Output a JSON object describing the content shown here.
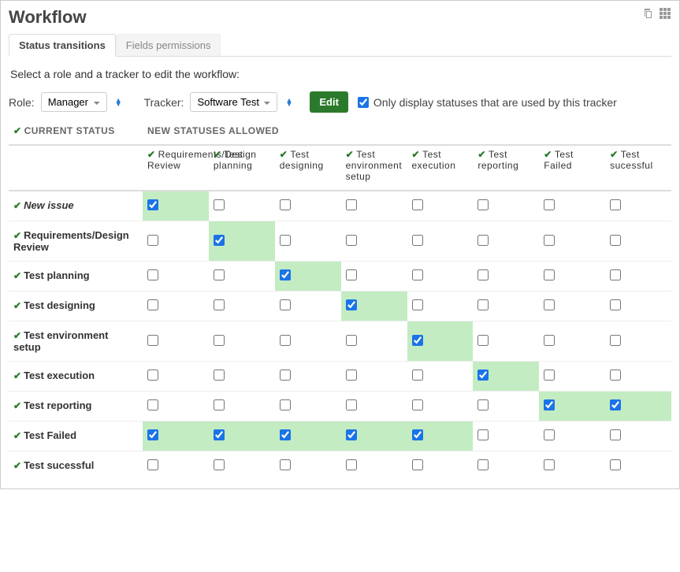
{
  "header": {
    "title": "Workflow"
  },
  "tabs": {
    "status_transitions": "Status transitions",
    "fields_permissions": "Fields permissions"
  },
  "intro": "Select a role and a tracker to edit the workflow:",
  "controls": {
    "role_label": "Role:",
    "role_value": "Manager",
    "tracker_label": "Tracker:",
    "tracker_value": "Software Test",
    "edit_label": "Edit",
    "filter_label": "Only display statuses that are used by this tracker",
    "filter_checked": true
  },
  "table": {
    "current_status_header": "CURRENT STATUS",
    "new_statuses_header": "NEW STATUSES ALLOWED",
    "columns": [
      "Requirements/Design Review",
      "Test planning",
      "Test designing",
      "Test environment setup",
      "Test execution",
      "Test reporting",
      "Test Failed",
      "Test sucessful"
    ],
    "rows": [
      {
        "label": "New issue",
        "italic": true,
        "cells": [
          {
            "v": true,
            "hl": true
          },
          {
            "v": false
          },
          {
            "v": false
          },
          {
            "v": false
          },
          {
            "v": false
          },
          {
            "v": false
          },
          {
            "v": false
          },
          {
            "v": false
          }
        ]
      },
      {
        "label": "Requirements/Design Review",
        "cells": [
          {
            "v": false
          },
          {
            "v": true,
            "hl": true
          },
          {
            "v": false
          },
          {
            "v": false
          },
          {
            "v": false
          },
          {
            "v": false
          },
          {
            "v": false
          },
          {
            "v": false
          }
        ]
      },
      {
        "label": "Test planning",
        "cells": [
          {
            "v": false
          },
          {
            "v": false
          },
          {
            "v": true,
            "hl": true
          },
          {
            "v": false
          },
          {
            "v": false
          },
          {
            "v": false
          },
          {
            "v": false
          },
          {
            "v": false
          }
        ]
      },
      {
        "label": "Test designing",
        "cells": [
          {
            "v": false
          },
          {
            "v": false
          },
          {
            "v": false
          },
          {
            "v": true,
            "hl": true
          },
          {
            "v": false
          },
          {
            "v": false
          },
          {
            "v": false
          },
          {
            "v": false
          }
        ]
      },
      {
        "label": "Test environment setup",
        "cells": [
          {
            "v": false
          },
          {
            "v": false
          },
          {
            "v": false
          },
          {
            "v": false
          },
          {
            "v": true,
            "hl": true
          },
          {
            "v": false
          },
          {
            "v": false
          },
          {
            "v": false
          }
        ]
      },
      {
        "label": "Test execution",
        "cells": [
          {
            "v": false
          },
          {
            "v": false
          },
          {
            "v": false
          },
          {
            "v": false
          },
          {
            "v": false
          },
          {
            "v": true,
            "hl": true
          },
          {
            "v": false
          },
          {
            "v": false
          }
        ]
      },
      {
        "label": "Test reporting",
        "cells": [
          {
            "v": false
          },
          {
            "v": false
          },
          {
            "v": false
          },
          {
            "v": false
          },
          {
            "v": false
          },
          {
            "v": false
          },
          {
            "v": true,
            "hl": true
          },
          {
            "v": true,
            "hl": true
          }
        ]
      },
      {
        "label": "Test Failed",
        "cells": [
          {
            "v": true,
            "hl": true
          },
          {
            "v": true,
            "hl": true
          },
          {
            "v": true,
            "hl": true
          },
          {
            "v": true,
            "hl": true
          },
          {
            "v": true,
            "hl": true
          },
          {
            "v": false
          },
          {
            "v": false
          },
          {
            "v": false
          }
        ]
      },
      {
        "label": "Test sucessful",
        "cells": [
          {
            "v": false
          },
          {
            "v": false
          },
          {
            "v": false
          },
          {
            "v": false
          },
          {
            "v": false
          },
          {
            "v": false
          },
          {
            "v": false
          },
          {
            "v": false
          }
        ]
      }
    ]
  }
}
